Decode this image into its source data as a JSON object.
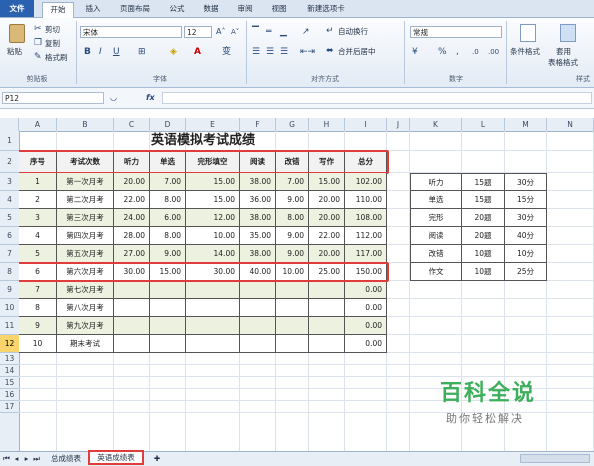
{
  "ribbon": {
    "tabs": [
      "文件",
      "开始",
      "插入",
      "页面布局",
      "公式",
      "数据",
      "审阅",
      "视图",
      "新建选项卡"
    ],
    "clipboard": {
      "paste": "粘贴",
      "cut": "剪切",
      "copy": "复制",
      "format_painter": "格式刷",
      "label": "剪贴板"
    },
    "font": {
      "name": "宋体",
      "size": "12",
      "label": "字体"
    },
    "alignment": {
      "wrap": "自动换行",
      "merge": "合并后居中",
      "label": "对齐方式"
    },
    "number": {
      "format": "常规",
      "label": "数字"
    },
    "styles": {
      "conditional": "条件格式",
      "table_format_line1": "套用",
      "table_format_line2": "表格格式",
      "label": "样式"
    }
  },
  "formula_bar": {
    "name_box": "P12",
    "fx": "fx",
    "value": ""
  },
  "columns": [
    "A",
    "B",
    "C",
    "D",
    "E",
    "F",
    "G",
    "H",
    "I",
    "J",
    "K",
    "L",
    "M",
    "N"
  ],
  "rows": [
    "1",
    "2",
    "3",
    "4",
    "5",
    "6",
    "7",
    "8",
    "9",
    "10",
    "11",
    "12",
    "13",
    "14",
    "15",
    "16",
    "17"
  ],
  "table": {
    "title": "英语模拟考试成绩",
    "headers": [
      "序号",
      "考试次数",
      "听力",
      "单选",
      "完形填空",
      "阅读",
      "改错",
      "写作",
      "总分"
    ],
    "rows": [
      [
        "1",
        "第一次月考",
        "20.00",
        "7.00",
        "15.00",
        "38.00",
        "7.00",
        "15.00",
        "102.00"
      ],
      [
        "2",
        "第二次月考",
        "22.00",
        "8.00",
        "15.00",
        "36.00",
        "9.00",
        "20.00",
        "110.00"
      ],
      [
        "3",
        "第三次月考",
        "24.00",
        "6.00",
        "12.00",
        "38.00",
        "8.00",
        "20.00",
        "108.00"
      ],
      [
        "4",
        "第四次月考",
        "28.00",
        "8.00",
        "10.00",
        "35.00",
        "9.00",
        "22.00",
        "112.00"
      ],
      [
        "5",
        "第五次月考",
        "27.00",
        "9.00",
        "14.00",
        "38.00",
        "9.00",
        "20.00",
        "117.00"
      ],
      [
        "6",
        "第六次月考",
        "30.00",
        "15.00",
        "30.00",
        "40.00",
        "10.00",
        "25.00",
        "150.00"
      ],
      [
        "7",
        "第七次月考",
        "",
        "",
        "",
        "",
        "",
        "",
        "0.00"
      ],
      [
        "8",
        "第八次月考",
        "",
        "",
        "",
        "",
        "",
        "",
        "0.00"
      ],
      [
        "9",
        "第九次月考",
        "",
        "",
        "",
        "",
        "",
        "",
        "0.00"
      ],
      [
        "10",
        "期末考试",
        "",
        "",
        "",
        "",
        "",
        "",
        "0.00"
      ]
    ]
  },
  "side_table": [
    [
      "听力",
      "15题",
      "30分"
    ],
    [
      "单选",
      "15题",
      "15分"
    ],
    [
      "完形",
      "20题",
      "30分"
    ],
    [
      "阅读",
      "20题",
      "40分"
    ],
    [
      "改错",
      "10题",
      "10分"
    ],
    [
      "作文",
      "10题",
      "25分"
    ]
  ],
  "sheets": [
    "总成绩表",
    "英语成绩表"
  ],
  "watermark": {
    "title": "百科全说",
    "subtitle": "助你轻松解决"
  },
  "colors": {
    "accent": "#e03c3c",
    "band": "#ecf2df",
    "header_bg": "#f2f2f2",
    "ribbon": "#dbe5f1",
    "watermark": "#3daf5a"
  }
}
